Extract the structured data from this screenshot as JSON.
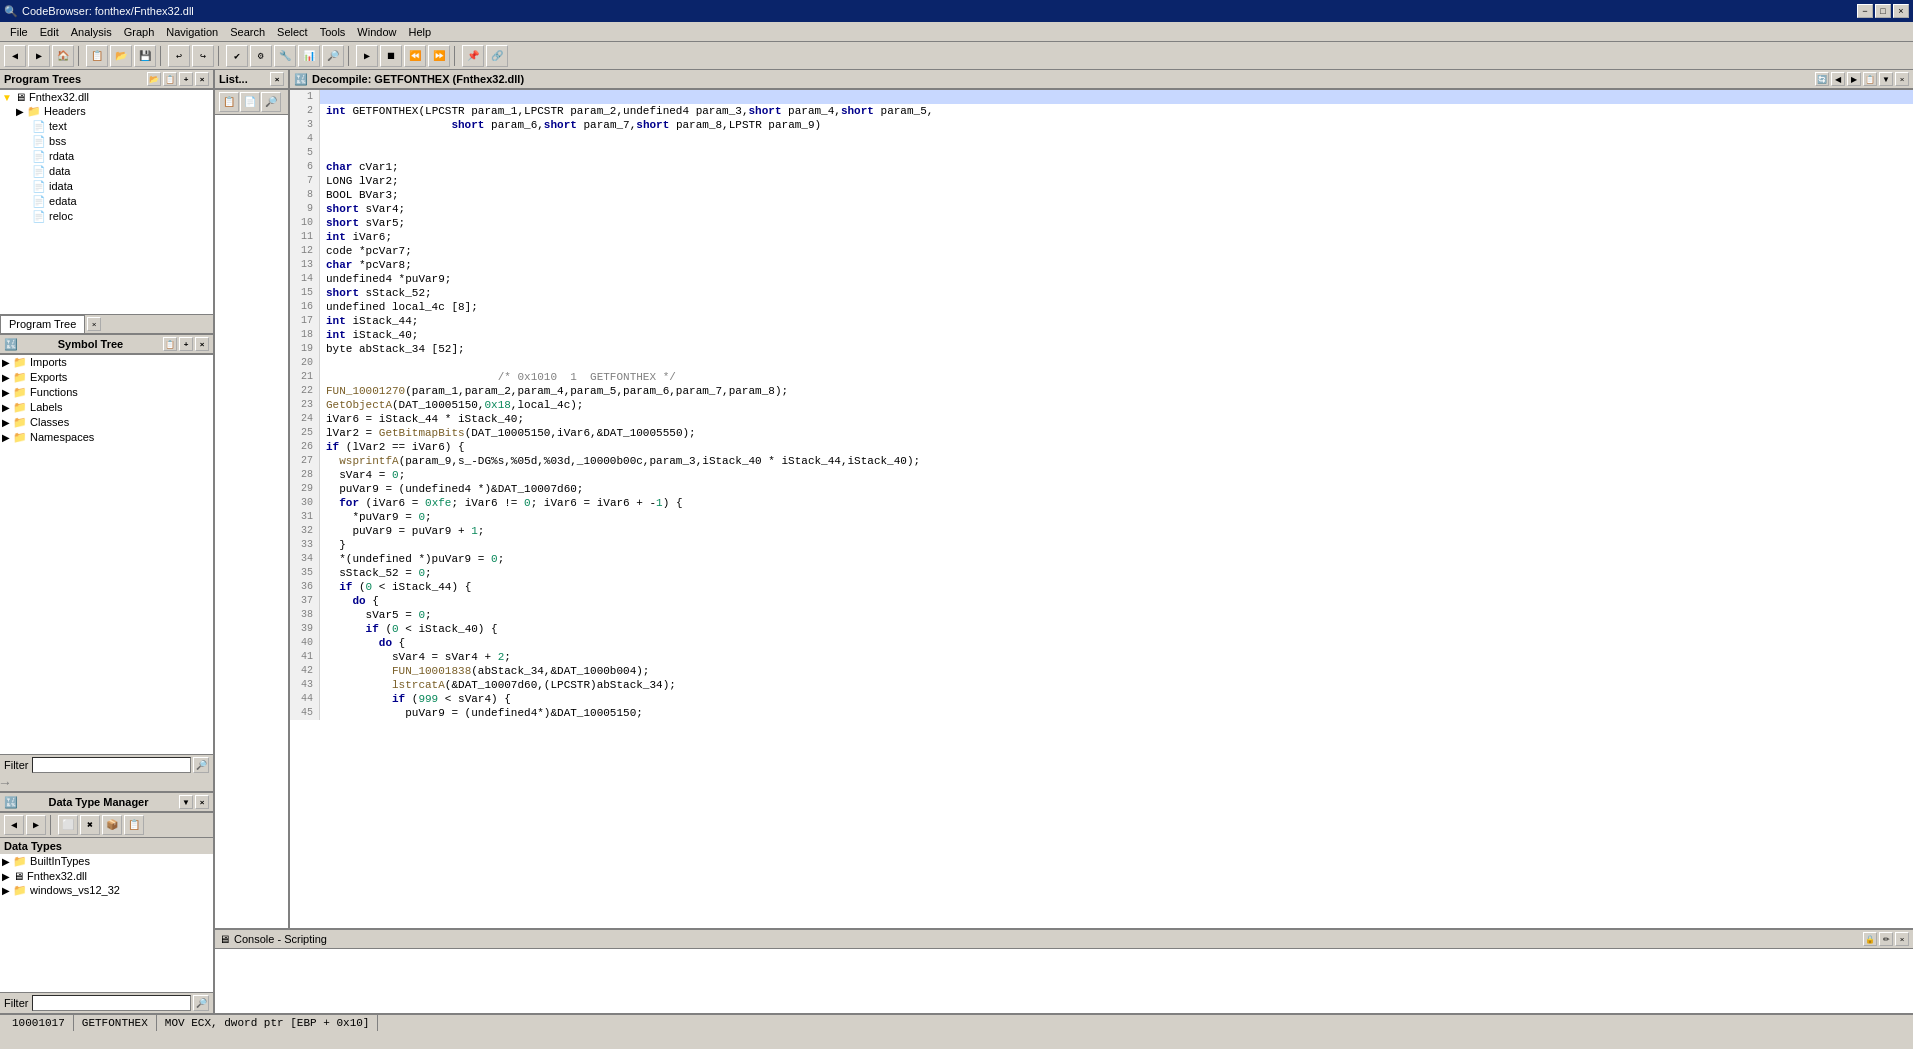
{
  "titleBar": {
    "title": "CodeBrowser: fonthex/Fnthex32.dll",
    "minimizeBtn": "−",
    "maximizeBtn": "□",
    "closeBtn": "×"
  },
  "menuBar": {
    "items": [
      "File",
      "Edit",
      "Analysis",
      "Graph",
      "Navigation",
      "Search",
      "Select",
      "Tools",
      "Window",
      "Help"
    ]
  },
  "programTreePanel": {
    "title": "Program Trees",
    "tree": [
      {
        "label": "Fnthex32.dll",
        "level": 0,
        "type": "root"
      },
      {
        "label": "Headers",
        "level": 1,
        "type": "folder"
      },
      {
        "label": "text",
        "level": 2,
        "type": "folder"
      },
      {
        "label": "bss",
        "level": 2,
        "type": "folder"
      },
      {
        "label": "rdata",
        "level": 2,
        "type": "folder"
      },
      {
        "label": "data",
        "level": 2,
        "type": "folder"
      },
      {
        "label": "idata",
        "level": 2,
        "type": "folder"
      },
      {
        "label": "edata",
        "level": 2,
        "type": "folder"
      },
      {
        "label": "reloc",
        "level": 2,
        "type": "folder"
      }
    ]
  },
  "programTreeTab": "Program Tree",
  "symbolTreePanel": {
    "title": "Symbol Tree",
    "tree": [
      {
        "label": "Imports",
        "level": 0,
        "type": "folder"
      },
      {
        "label": "Exports",
        "level": 0,
        "type": "folder"
      },
      {
        "label": "Functions",
        "level": 0,
        "type": "folder",
        "selected": true
      },
      {
        "label": "Labels",
        "level": 0,
        "type": "folder"
      },
      {
        "label": "Classes",
        "level": 0,
        "type": "folder"
      },
      {
        "label": "Namespaces",
        "level": 0,
        "type": "folder"
      }
    ]
  },
  "filterLabel": "Filter",
  "filterPlaceholder": "",
  "dataTypePanel": {
    "title": "Data Type Manager",
    "tree": [
      {
        "label": "BuiltInTypes",
        "level": 0,
        "type": "folder"
      },
      {
        "label": "Fnthex32.dll",
        "level": 0,
        "type": "file"
      },
      {
        "label": "windows_vs12_32",
        "level": 0,
        "type": "folder"
      }
    ]
  },
  "listPanel": {
    "title": "List..."
  },
  "decompilePanel": {
    "title": "Decompile: GETFONTHEX  (Fnthex32.dll)"
  },
  "consolePanel": {
    "title": "Console - Scripting"
  },
  "codeLines": [
    {
      "num": 1,
      "content": ""
    },
    {
      "num": 2,
      "content": "int GETFONTHEX(LPCSTR param_1,LPCSTR param_2,undefined4 param_3,short param_4,short param_5,"
    },
    {
      "num": 3,
      "content": "                   short param_6,short param_7,short param_8,LPSTR param_9)"
    },
    {
      "num": 4,
      "content": ""
    },
    {
      "num": 5,
      "content": ""
    },
    {
      "num": 6,
      "content": "char cVar1;"
    },
    {
      "num": 7,
      "content": "LONG lVar2;"
    },
    {
      "num": 8,
      "content": "BOOL BVar3;"
    },
    {
      "num": 9,
      "content": "short sVar4;"
    },
    {
      "num": 10,
      "content": "short sVar5;"
    },
    {
      "num": 11,
      "content": "int iVar6;"
    },
    {
      "num": 12,
      "content": "code *pcVar7;"
    },
    {
      "num": 13,
      "content": "char *pcVar8;"
    },
    {
      "num": 14,
      "content": "undefined4 *puVar9;"
    },
    {
      "num": 15,
      "content": "short sStack_52;"
    },
    {
      "num": 16,
      "content": "undefined local_4c [8];"
    },
    {
      "num": 17,
      "content": "int iStack_44;"
    },
    {
      "num": 18,
      "content": "int iStack_40;"
    },
    {
      "num": 19,
      "content": "byte abStack_34 [52];"
    },
    {
      "num": 20,
      "content": ""
    },
    {
      "num": 21,
      "content": "                          /* 0x1010  1  GETFONTHEX */"
    },
    {
      "num": 22,
      "content": "FUN_10001270(param_1,param_2,param_4,param_5,param_6,param_7,param_8);"
    },
    {
      "num": 23,
      "content": "GetObjectA(DAT_10005150,0x18,local_4c);"
    },
    {
      "num": 24,
      "content": "iVar6 = iStack_44 * iStack_40;"
    },
    {
      "num": 25,
      "content": "lVar2 = GetBitmapBits(DAT_10005150,iVar6,&DAT_10005550);"
    },
    {
      "num": 26,
      "content": "if (lVar2 == iVar6) {"
    },
    {
      "num": 27,
      "content": "  wsprintfA(param_9,s_-DG%s,%05d,%03d,_10000b00c,param_3,iStack_40 * iStack_44,iStack_40);"
    },
    {
      "num": 28,
      "content": "  sVar4 = 0;"
    },
    {
      "num": 29,
      "content": "  puVar9 = (undefined4 *)&DAT_10007d60;"
    },
    {
      "num": 30,
      "content": "  for (iVar6 = 0xfe; iVar6 != 0; iVar6 = iVar6 + -1) {"
    },
    {
      "num": 31,
      "content": "    *puVar9 = 0;"
    },
    {
      "num": 32,
      "content": "    puVar9 = puVar9 + 1;"
    },
    {
      "num": 33,
      "content": "  }"
    },
    {
      "num": 34,
      "content": "  *(undefined *)puVar9 = 0;"
    },
    {
      "num": 35,
      "content": "  sStack_52 = 0;"
    },
    {
      "num": 36,
      "content": "  if (0 < iStack_44) {"
    },
    {
      "num": 37,
      "content": "    do {"
    },
    {
      "num": 38,
      "content": "      sVar5 = 0;"
    },
    {
      "num": 39,
      "content": "      if (0 < iStack_40) {"
    },
    {
      "num": 40,
      "content": "        do {"
    },
    {
      "num": 41,
      "content": "          sVar4 = sVar4 + 2;"
    },
    {
      "num": 42,
      "content": "          FUN_10001838(abStack_34,&DAT_1000b004);"
    },
    {
      "num": 43,
      "content": "          lstrcatA(&DAT_10007d60,(LPCSTR)abStack_34);"
    },
    {
      "num": 44,
      "content": "          if (999 < sVar4) {"
    },
    {
      "num": 45,
      "content": "            puVar9 = (undefined4*)&DAT_10005150;"
    }
  ],
  "statusBar": {
    "address": "10001017",
    "function": "GETFONTHEX",
    "instruction": "MOV ECX, dword ptr [EBP + 0x10]"
  }
}
